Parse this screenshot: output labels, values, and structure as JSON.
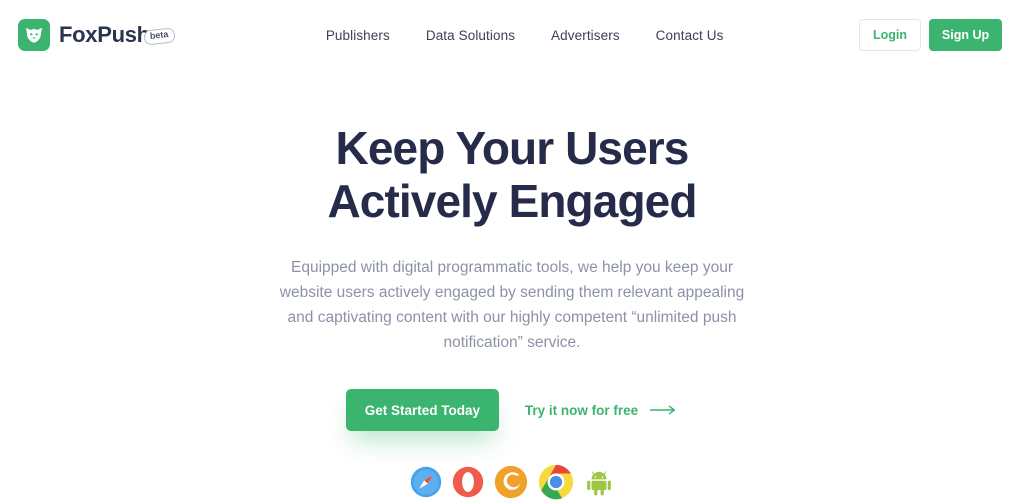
{
  "header": {
    "brand": {
      "name": "FoxPush",
      "badge": "beta",
      "logo_icon": "fox-logo-icon"
    },
    "nav": [
      {
        "label": "Publishers"
      },
      {
        "label": "Data Solutions"
      },
      {
        "label": "Advertisers"
      },
      {
        "label": "Contact Us"
      }
    ],
    "login_label": "Login",
    "signup_label": "Sign Up"
  },
  "hero": {
    "title_line1": "Keep Your Users",
    "title_line2": "Actively Engaged",
    "subtitle_line1": "Equipped with digital programmatic tools, we help you keep your",
    "subtitle_line2": "website users actively engaged by sending them relevant appealing",
    "subtitle_line3": "and captivating content with our highly competent",
    "subtitle_line4": "“unlimited push notification” service.",
    "primary_cta": "Get Started Today",
    "secondary_cta": "Try it now for free",
    "secondary_cta_icon": "arrow-right-icon"
  },
  "browsers": [
    {
      "name": "safari-icon",
      "label": "Safari"
    },
    {
      "name": "opera-icon",
      "label": "Opera"
    },
    {
      "name": "firefox-icon",
      "label": "Firefox"
    },
    {
      "name": "chrome-icon",
      "label": "Chrome"
    },
    {
      "name": "android-icon",
      "label": "Android"
    }
  ],
  "colors": {
    "brand_green": "#3ab46f",
    "headline_navy": "#252b48",
    "body_gray": "#8c92a6",
    "background": "#ffffff"
  }
}
